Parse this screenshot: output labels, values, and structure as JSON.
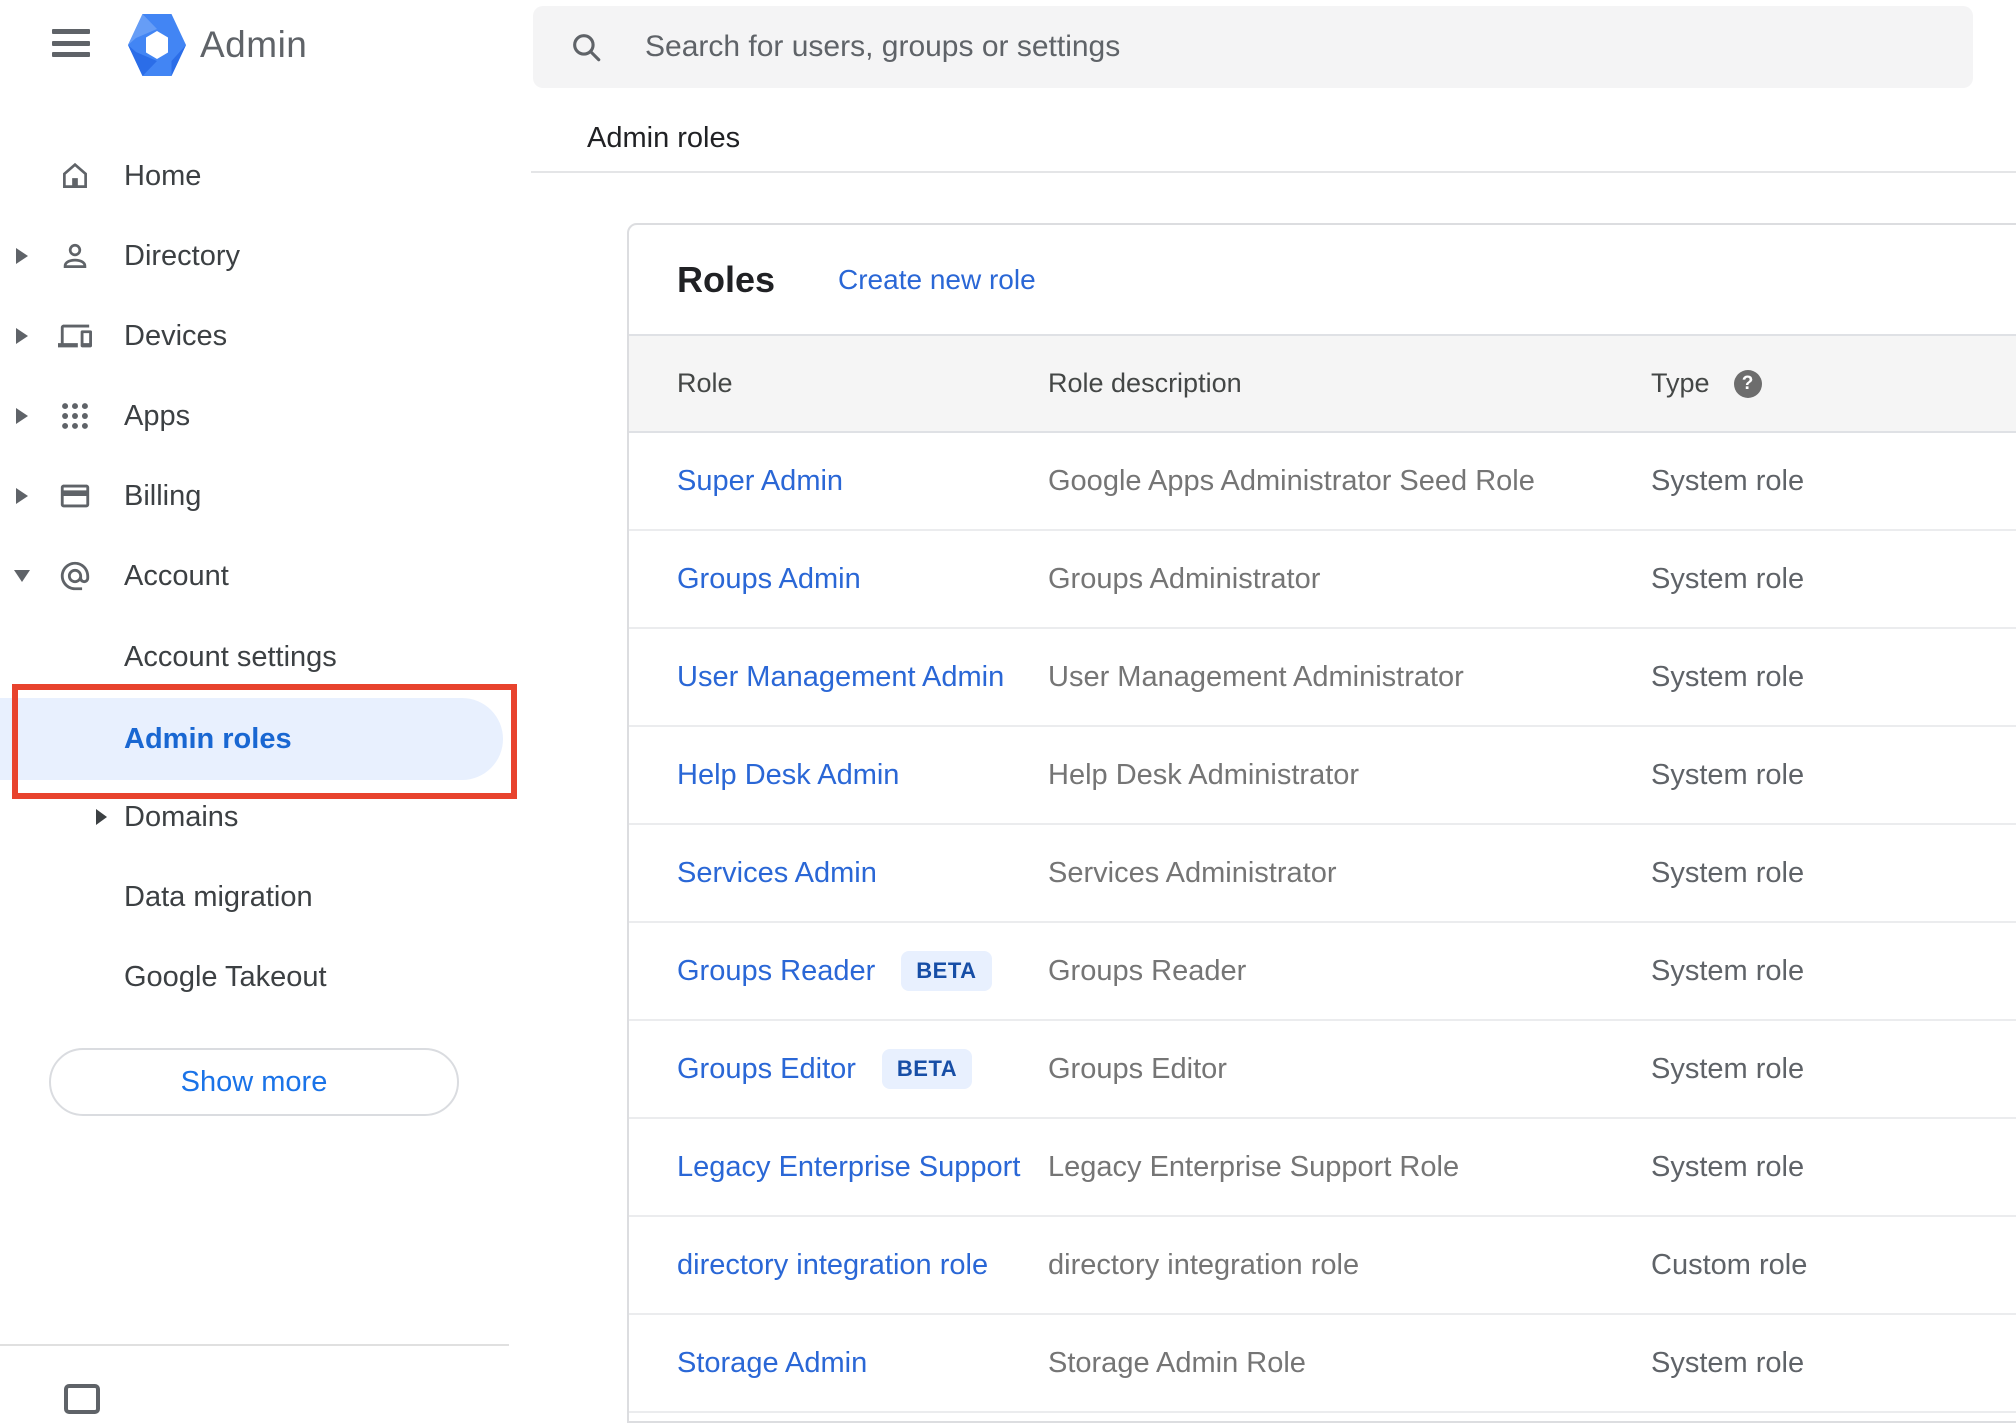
{
  "app": {
    "logo_label": "Admin"
  },
  "search": {
    "placeholder": "Search for users, groups or settings"
  },
  "breadcrumb": "Admin roles",
  "sidebar": {
    "items": [
      {
        "label": "Home",
        "icon": "home-icon",
        "arrow": "none"
      },
      {
        "label": "Directory",
        "icon": "person-icon",
        "arrow": "right"
      },
      {
        "label": "Devices",
        "icon": "devices-icon",
        "arrow": "right"
      },
      {
        "label": "Apps",
        "icon": "apps-grid-icon",
        "arrow": "right"
      },
      {
        "label": "Billing",
        "icon": "credit-card-icon",
        "arrow": "right"
      },
      {
        "label": "Account",
        "icon": "at-sign-icon",
        "arrow": "down"
      }
    ],
    "account_children": [
      {
        "label": "Account settings",
        "active": false,
        "arrow": "none"
      },
      {
        "label": "Admin roles",
        "active": true,
        "arrow": "none"
      },
      {
        "label": "Domains",
        "active": false,
        "arrow": "right"
      },
      {
        "label": "Data migration",
        "active": false,
        "arrow": "none"
      },
      {
        "label": "Google Takeout",
        "active": false,
        "arrow": "none"
      }
    ],
    "show_more_label": "Show more"
  },
  "roles_panel": {
    "title": "Roles",
    "create_link": "Create new role",
    "columns": [
      "Role",
      "Role description",
      "Type"
    ],
    "type_help_icon": "help-question-icon",
    "rows": [
      {
        "role": "Super Admin",
        "beta": false,
        "description": "Google Apps Administrator Seed Role",
        "type": "System role"
      },
      {
        "role": "Groups Admin",
        "beta": false,
        "description": "Groups Administrator",
        "type": "System role"
      },
      {
        "role": "User Management Admin",
        "beta": false,
        "description": "User Management Administrator",
        "type": "System role"
      },
      {
        "role": "Help Desk Admin",
        "beta": false,
        "description": "Help Desk Administrator",
        "type": "System role"
      },
      {
        "role": "Services Admin",
        "beta": false,
        "description": "Services Administrator",
        "type": "System role"
      },
      {
        "role": "Groups Reader",
        "beta": true,
        "beta_label": "BETA",
        "description": "Groups Reader",
        "type": "System role"
      },
      {
        "role": "Groups Editor",
        "beta": true,
        "beta_label": "BETA",
        "description": "Groups Editor",
        "type": "System role"
      },
      {
        "role": "Legacy Enterprise Support",
        "beta": false,
        "description": "Legacy Enterprise Support Role",
        "type": "System role"
      },
      {
        "role": "directory integration role",
        "beta": false,
        "description": "directory integration role",
        "type": "Custom role"
      },
      {
        "role": "Storage Admin",
        "beta": false,
        "description": "Storage Admin Role",
        "type": "System role"
      }
    ]
  },
  "annotation": {
    "shape": "red-highlight-box",
    "color": "#e8432d",
    "target": "Admin roles"
  },
  "colors": {
    "link_blue": "#2a67d6",
    "active_nav_blue": "#1967d2",
    "active_pill_bg": "#e8f0fe",
    "beta_text": "#174ea6",
    "annotation_red": "#e8432d",
    "search_bg": "#f4f4f5",
    "table_header_bg": "#f5f5f5",
    "icon_gray": "#5f6368",
    "text_dark": "#202124"
  }
}
